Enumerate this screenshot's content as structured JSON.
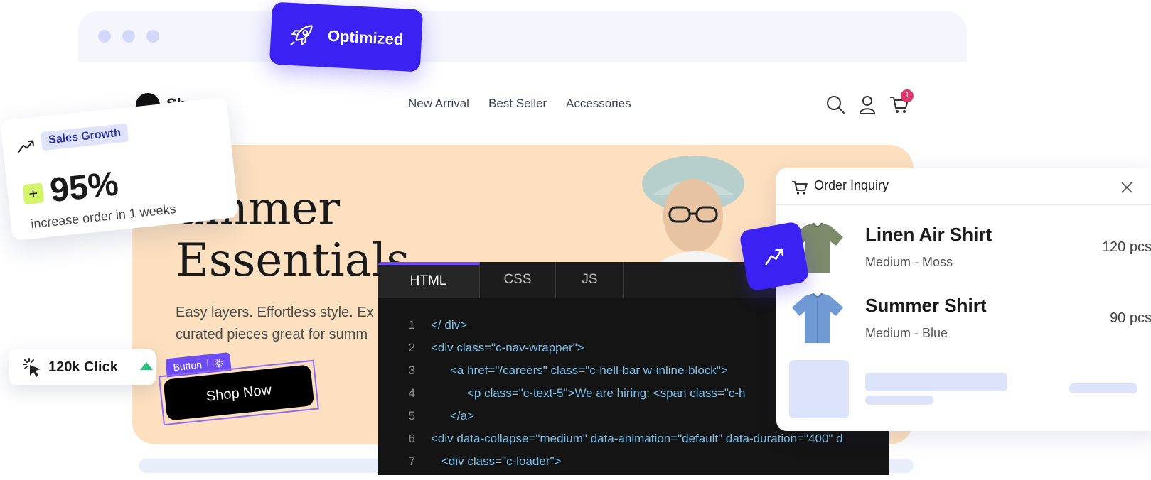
{
  "badge": {
    "label": "Optimized",
    "icon": "rocket-icon",
    "color": "#3b22f2"
  },
  "brand": {
    "logo_text": "Sh"
  },
  "nav": {
    "items": [
      "New Arrival",
      "Best Seller",
      "Accessories"
    ],
    "cart_count": "1"
  },
  "hero": {
    "title_line1": "ummer",
    "title_line2": "Essentials",
    "subtitle_line1": "Easy layers. Effortless style. Ex",
    "subtitle_line2": "curated pieces great for summ"
  },
  "sales_card": {
    "tag": "Sales Growth",
    "plus": "+",
    "value": "95%",
    "description": "increase order in 1 weeks"
  },
  "click_card": {
    "label": "120k Click"
  },
  "shop_button": {
    "tag_label": "Button",
    "label": "Shop Now"
  },
  "editor": {
    "tabs": [
      "HTML",
      "CSS",
      "JS"
    ],
    "active_tab": "HTML",
    "lines": [
      {
        "num": "1",
        "text": "</ div>"
      },
      {
        "num": "2",
        "text": "<div class=\"c-nav-wrapper\">"
      },
      {
        "num": "3",
        "text": "<a href=\"/careers\" class=\"c-hell-bar w-inline-block\">"
      },
      {
        "num": "4",
        "text": "<p class=\"c-text-5\">We are hiring: <span class=\"c-h"
      },
      {
        "num": "5",
        "text": "</a>"
      },
      {
        "num": "6",
        "text": "<div data-collapse=\"medium\" data-animation=\"default\" data-duration=\"400\" d"
      },
      {
        "num": "7",
        "text": "<div class=\"c-loader\">"
      }
    ]
  },
  "order_card": {
    "title": "Order Inquiry",
    "items": [
      {
        "name": "Linen Air Shirt",
        "variant": "Medium - Moss",
        "qty": "120 pcs",
        "color": "#7d8a6a"
      },
      {
        "name": "Summer  Shirt",
        "variant": "Medium - Blue",
        "qty": "90 pcs",
        "color": "#6f9ad3"
      }
    ]
  },
  "colors": {
    "accent": "#3b22f2",
    "editor_accent": "#6d4cf6",
    "hero_bg": "#fde0bf",
    "lime": "#d4f56a",
    "growth_green": "#2ec27e",
    "badge_pink": "#e0356d"
  }
}
